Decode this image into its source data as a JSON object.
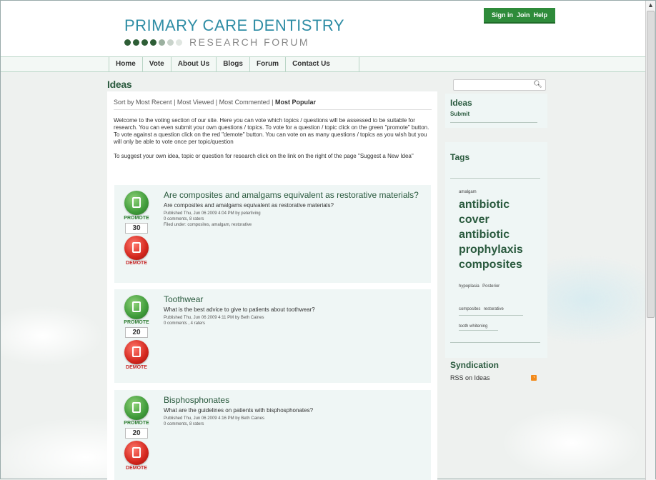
{
  "header": {
    "logo_top": "PRIMARY CARE DENTISTRY",
    "logo_bottom": "RESEARCH FORUM",
    "top_links": [
      "Sign in",
      "Join",
      "Help"
    ]
  },
  "nav": [
    "Home",
    "Vote",
    "About Us",
    "Blogs",
    "Forum",
    "Contact Us"
  ],
  "page_title": "Ideas",
  "sort": {
    "prefix": "Sort by",
    "options": [
      "Most Recent",
      "Most Viewed",
      "Most Commented",
      "Most Popular"
    ],
    "active": "Most Popular"
  },
  "intro": [
    "Welcome to the voting section of our site. Here you can vote which topics / questions will be assessed to be suitable for research. You can even submit your own questions / topics. To vote for a question / topic click on the green \"promote\" button. To vote against a question click on the red \"demote\" button. You can vote on as many questions / topics as you wish but you will only be able to vote once per topic/question",
    "To suggest your own idea, topic or question for research click on the link on the right of the page \"Suggest a New Idea\""
  ],
  "vote_labels": {
    "promote": "PROMOTE",
    "demote": "DEMOTE"
  },
  "ideas": [
    {
      "title": "Are composites and amalgams equivalent as restorative materials?",
      "description": "Are composites and amalgams equivalent as restorative materials?",
      "published": "Published Thu, Jun 06 2009 4:04 PM by peterliving",
      "comments": "0 comments, 8 raters",
      "filed": "Filed under: composites, amalgam, restorative",
      "votes": "30"
    },
    {
      "title": "Toothwear",
      "description": "What is the best advice to give to patients about toothwear?",
      "published": "Published Thu, Jun 06 2009 4:11 PM by Beth Caines",
      "comments": "0 comments , 4 raters",
      "filed": "",
      "votes": "20"
    },
    {
      "title": "Bisphosphonates",
      "description": "What are the guidelines on patients with bisphosphonates?",
      "published": "Published Thu, Jun 06 2009 4:16 PM by Beth Caines",
      "comments": "0 comments, 8 raters",
      "filed": "",
      "votes": "20"
    }
  ],
  "sidebar": {
    "ideas_heading": "Ideas",
    "submit_link": "Submit",
    "tags_heading": "Tags",
    "tags": {
      "amalgam": "amalgam",
      "antibiotic_cover": "antibiotic cover",
      "antibiotic_prophylaxis": "antibiotic prophylaxis",
      "composites": "composites",
      "hypoplasia": "hypoplasia",
      "posterior": "Posterior",
      "composites_small": "composites",
      "restorative": "restorative",
      "tooth_whitening": "tooth whitening"
    },
    "syndication_heading": "Syndication",
    "rss_link": "RSS on Ideas"
  },
  "colors": {
    "brand_blue": "#2f8da5",
    "brand_green": "#2e8b3a",
    "heading_green": "#2a5a3e",
    "promote_green": "#3f9b3a",
    "demote_red": "#d3261d",
    "rss_orange": "#f28a1a"
  }
}
